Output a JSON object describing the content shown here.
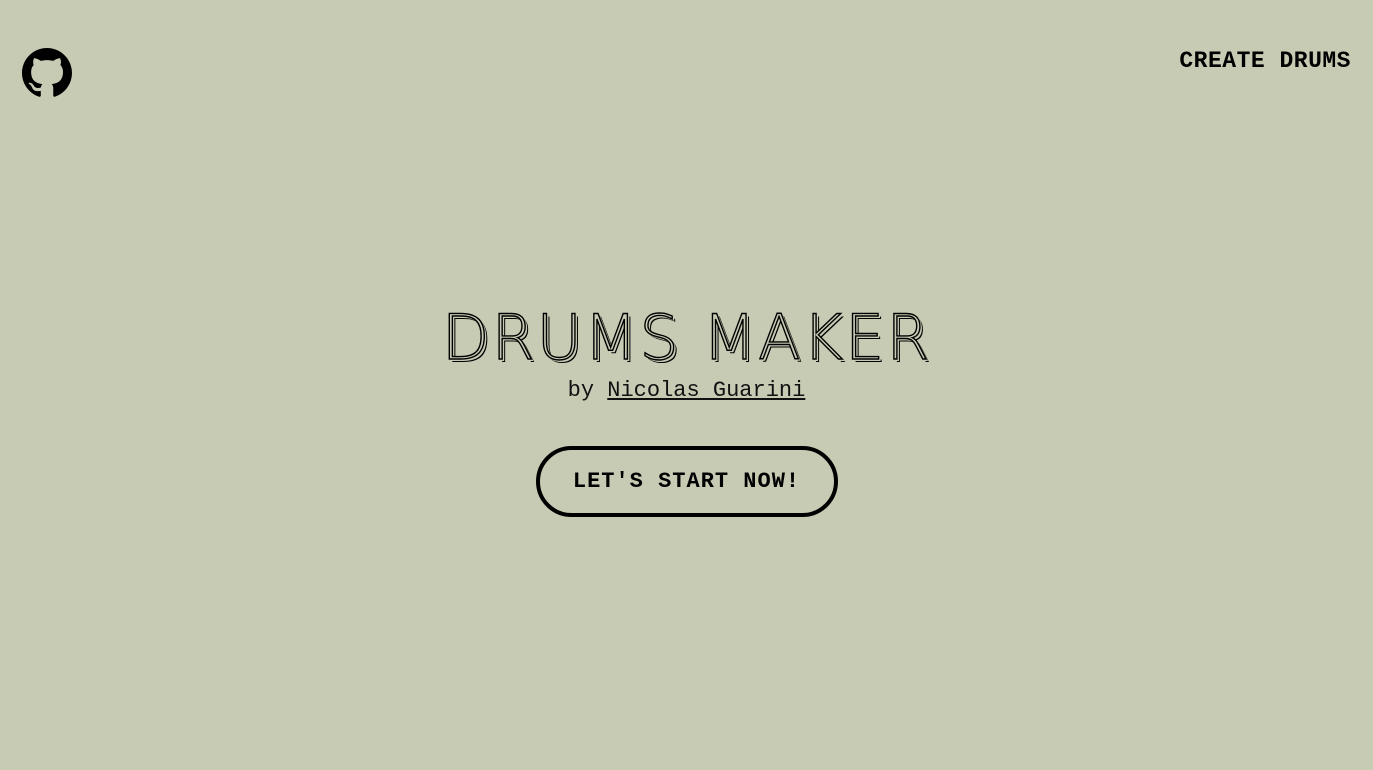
{
  "header": {
    "github_icon": "github-icon",
    "nav_link": "CREATE DRUMS"
  },
  "hero": {
    "title": "DRUMS MAKER",
    "byline_prefix": "by",
    "author": "Nicolas Guarini",
    "cta_label": "LET'S START NOW!"
  },
  "colors": {
    "background": "#c8cbb4",
    "foreground": "#000000"
  }
}
